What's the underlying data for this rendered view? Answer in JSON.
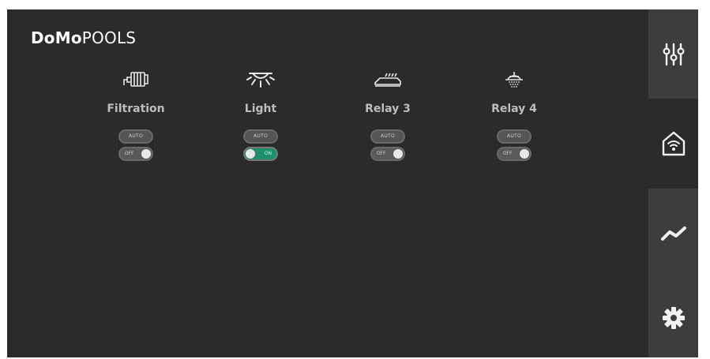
{
  "app": {
    "brand_bold": "DoMo",
    "brand_light": "POOLS"
  },
  "devices": [
    {
      "name": "Filtration",
      "icon": "pump-icon",
      "auto_label": "AUTO",
      "state_label": "OFF",
      "state": "off"
    },
    {
      "name": "Light",
      "icon": "pool-light-icon",
      "auto_label": "AUTO",
      "state_label": "ON",
      "state": "on"
    },
    {
      "name": "Relay 3",
      "icon": "heater-icon",
      "auto_label": "AUTO",
      "state_label": "OFF",
      "state": "off"
    },
    {
      "name": "Relay 4",
      "icon": "shower-icon",
      "auto_label": "AUTO",
      "state_label": "OFF",
      "state": "off"
    }
  ],
  "sidebar": [
    {
      "icon": "sliders-icon",
      "active": false
    },
    {
      "icon": "smart-home-icon",
      "active": true
    },
    {
      "icon": "trend-chart-icon",
      "active": false
    },
    {
      "icon": "gear-icon",
      "active": false
    }
  ],
  "colors": {
    "background": "#2b2b2b",
    "sidebar": "#3d3d3d",
    "toggle_on": "#1e8f6c",
    "text": "#bdbdbd"
  }
}
